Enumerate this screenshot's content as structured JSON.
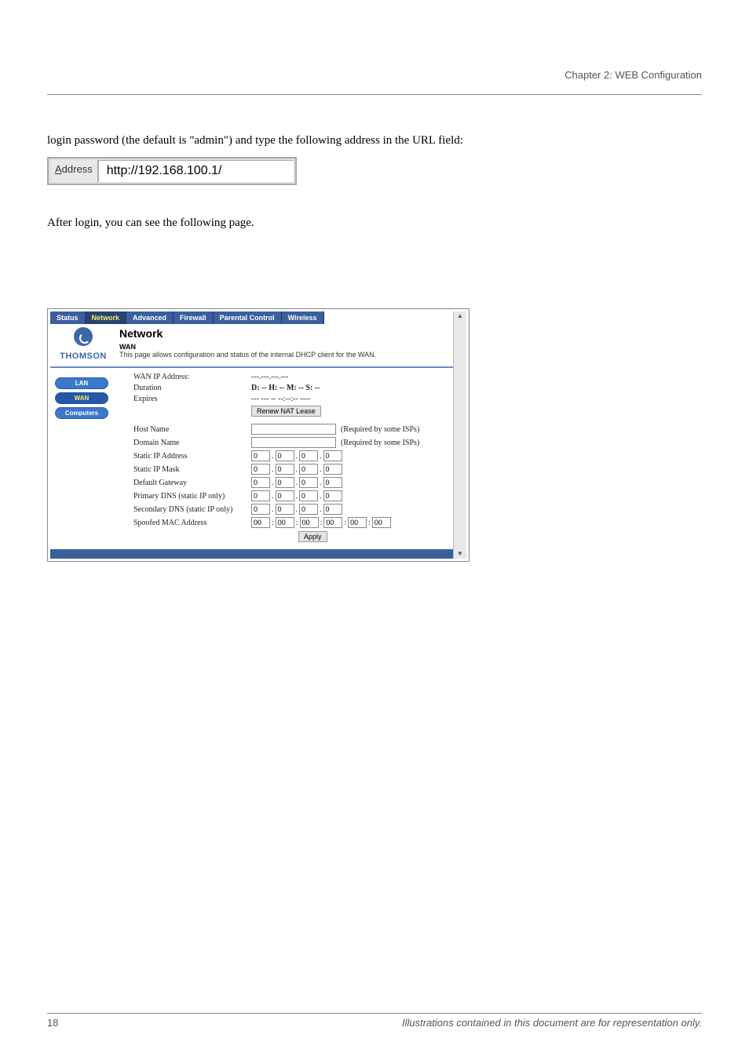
{
  "page_header": {
    "chapter": "Chapter 2: WEB Configuration"
  },
  "intro_text": "login password (the default is \"admin\") and type the following address in the URL field:",
  "address_bar": {
    "label": "Address",
    "url": "http://192.168.100.1/"
  },
  "after_address_text": "After login, you can see the following page.",
  "router_ui": {
    "tabs": [
      "Status",
      "Network",
      "Advanced",
      "Firewall",
      "Parental Control",
      "Wireless"
    ],
    "active_tab": "Network",
    "brand": "THOMSON",
    "section_title": "Network",
    "section_sub": "WAN",
    "section_desc": "This page allows configuration and status of the internal DHCP client for the WAN.",
    "sidenav": [
      {
        "label": "LAN",
        "active": false
      },
      {
        "label": "WAN",
        "active": true
      },
      {
        "label": "Computers",
        "active": false
      }
    ],
    "status_rows": [
      {
        "label": "WAN IP Address:",
        "value": "---.---.---.---"
      },
      {
        "label": "Duration",
        "value": "D: -- H: -- M: -- S: --"
      },
      {
        "label": "Expires",
        "value": "--- --- -- --:--:-- ----"
      }
    ],
    "renew_button": "Renew NAT Lease",
    "form_rows": [
      {
        "label": "Host Name",
        "type": "text",
        "hint": "(Required by some ISPs)"
      },
      {
        "label": "Domain Name",
        "type": "text",
        "hint": "(Required by some ISPs)"
      },
      {
        "label": "Static IP Address",
        "type": "ip",
        "values": [
          "0",
          "0",
          "0",
          "0"
        ]
      },
      {
        "label": "Static IP Mask",
        "type": "ip",
        "values": [
          "0",
          "0",
          "0",
          "0"
        ]
      },
      {
        "label": "Default Gateway",
        "type": "ip",
        "values": [
          "0",
          "0",
          "0",
          "0"
        ]
      },
      {
        "label": "Primary DNS (static IP only)",
        "type": "ip",
        "values": [
          "0",
          "0",
          "0",
          "0"
        ]
      },
      {
        "label": "Secondary DNS (static IP only)",
        "type": "ip",
        "values": [
          "0",
          "0",
          "0",
          "0"
        ]
      },
      {
        "label": "Spoofed MAC Address",
        "type": "mac",
        "values": [
          "00",
          "00",
          "00",
          "00",
          "00",
          "00"
        ]
      }
    ],
    "apply_button": "Apply"
  },
  "footer": {
    "page_number": "18",
    "right": "Illustrations contained in this document are for representation only."
  }
}
